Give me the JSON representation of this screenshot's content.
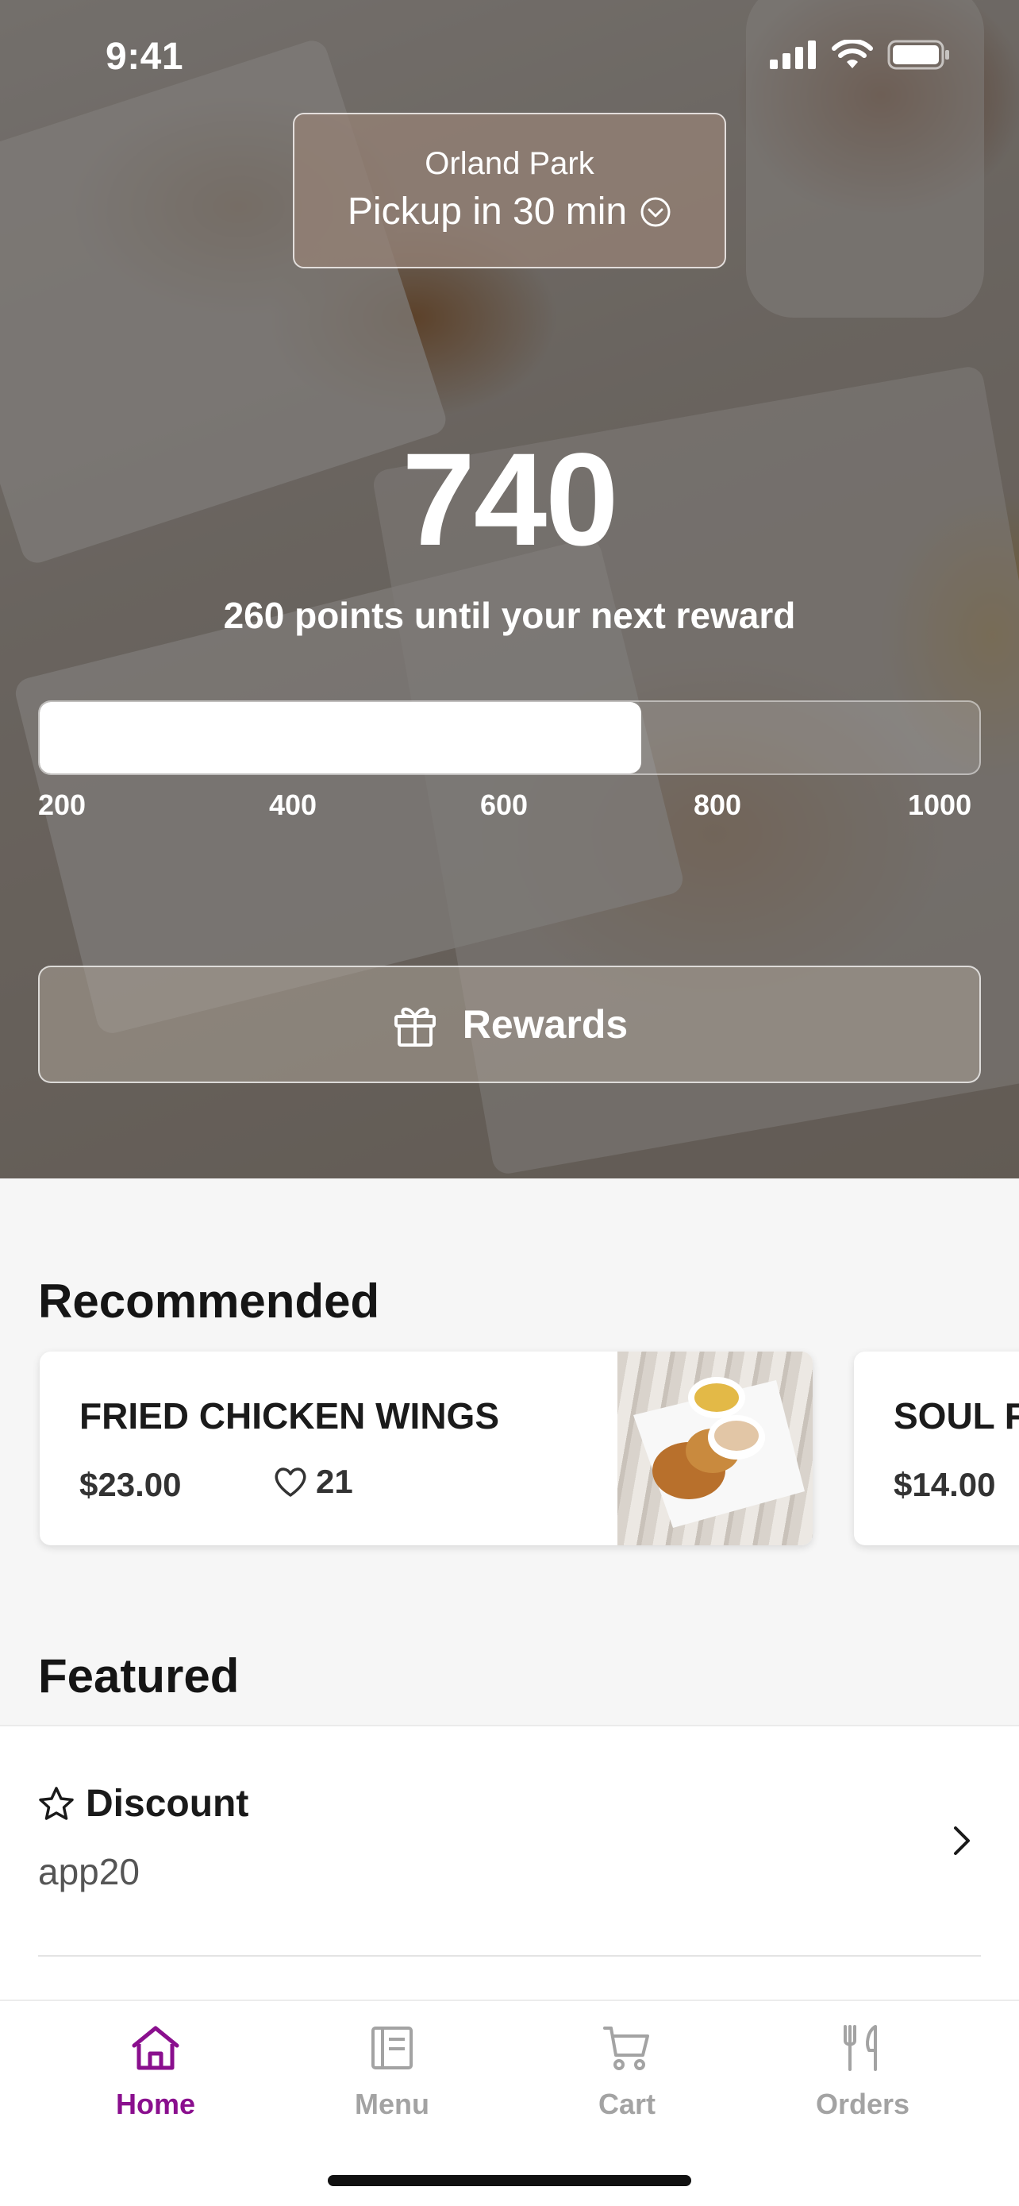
{
  "status_bar": {
    "time": "9:41"
  },
  "location": {
    "name": "Orland Park",
    "pickup": "Pickup in 30 min"
  },
  "points": {
    "value": "740",
    "caption": "260 points until your next reward",
    "progress": 0.64,
    "ticks": [
      "200",
      "400",
      "600",
      "800",
      "1000"
    ]
  },
  "rewards_button": {
    "label": "Rewards",
    "icon": "gift-icon"
  },
  "recommended": {
    "title": "Recommended",
    "items": [
      {
        "name": "FRIED CHICKEN WINGS",
        "price": "$23.00",
        "likes": "21"
      },
      {
        "name": "SOUL F",
        "price": "$14.00"
      }
    ]
  },
  "featured": {
    "title": "Featured",
    "items": [
      {
        "title": "Discount",
        "code": "app20",
        "icon": "star-icon"
      }
    ]
  },
  "tabs": [
    {
      "label": "Home",
      "icon": "home-icon",
      "active": true
    },
    {
      "label": "Menu",
      "icon": "menu-icon",
      "active": false
    },
    {
      "label": "Cart",
      "icon": "cart-icon",
      "active": false
    },
    {
      "label": "Orders",
      "icon": "utensils-icon",
      "active": false
    }
  ],
  "colors": {
    "accent": "#8a0f8e",
    "inactive_tab": "#a3a3a3"
  }
}
